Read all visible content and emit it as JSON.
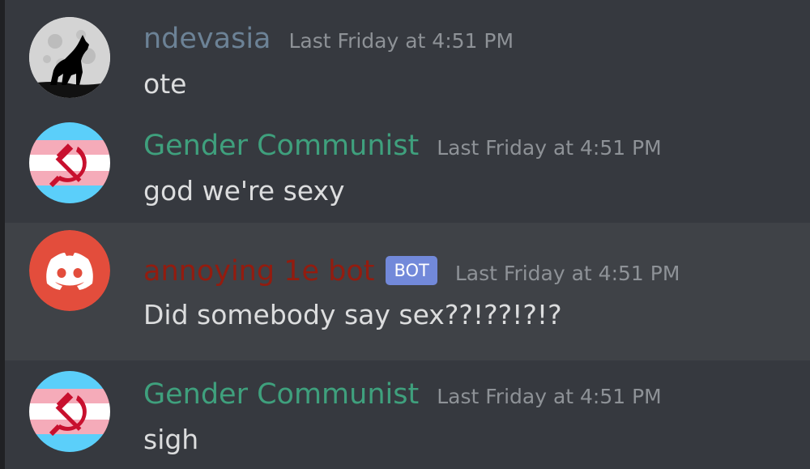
{
  "messages": [
    {
      "username": "ndevasia",
      "username_color": "#6c8296",
      "timestamp": "Last Friday at 4:51 PM",
      "text": "ote",
      "avatar": "wolf-moon-icon"
    },
    {
      "username": "Gender Communist",
      "username_color": "#3fa07d",
      "timestamp": "Last Friday at 4:51 PM",
      "text": "god we're sexy",
      "avatar": "trans-flag-hammer-sickle-icon"
    },
    {
      "username": "annoying 1e bot",
      "username_color": "#931c0f",
      "badge": "BOT",
      "badge_color": "#7289da",
      "timestamp": "Last Friday at 4:51 PM",
      "text": "Did somebody say sex??!??!?!?",
      "avatar": "discord-logo-icon",
      "avatar_color": "#e34d3c"
    },
    {
      "username": "Gender Communist",
      "username_color": "#3fa07d",
      "timestamp": "Last Friday at 4:51 PM",
      "text": "sigh",
      "avatar": "trans-flag-hammer-sickle-icon"
    }
  ],
  "colors": {
    "background": "#36393f",
    "highlight": "#3f4247",
    "text": "#dcddde",
    "timestamp": "#8e9297"
  }
}
